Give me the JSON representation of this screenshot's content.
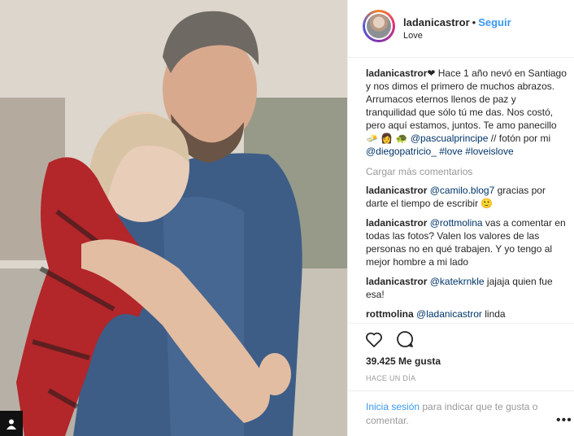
{
  "post": {
    "username": "ladanicastror",
    "separator": "•",
    "follow_label": "Seguir",
    "location": "Love"
  },
  "caption": {
    "username": "ladanicastror",
    "text_1": "❤ Hace 1 año nevó en Santiago y nos dimos el primero de muchos abrazos. Arrumacos eternos llenos de paz y tranquilidad que sólo tú me das. Nos costó, pero aquí estamos, juntos. Te amo panecillo 🧈 👩 🐢 ",
    "mention_1": "@pascualprincipe",
    "text_2": " // fotón por mi ",
    "mention_2": "@diegopatricio_",
    "text_3": " ",
    "tag_1": "#love",
    "text_4": " ",
    "tag_2": "#loveislove"
  },
  "load_more_label": "Cargar más comentarios",
  "comments": [
    {
      "username": "ladanicastror",
      "mention": "@camilo.blog7",
      "text": " gracias por darte el tiempo de escribir 🙂"
    },
    {
      "username": "ladanicastror",
      "mention": "@rottmolina",
      "text": " vas a comentar en todas las fotos? Valen los valores de las personas no en qué trabajen. Y yo tengo al mejor hombre a mi lado"
    },
    {
      "username": "ladanicastror",
      "mention": "@katekrnkle",
      "text": " jajaja quien fue esa!"
    },
    {
      "username": "rottmolina",
      "mention": "@ladanicastror",
      "text": " linda"
    }
  ],
  "likes_label": "39.425 Me gusta",
  "time_label": "HACE UN DÍA",
  "login": {
    "link": "Inicia sesión",
    "text": " para indicar que te gusta o comentar."
  },
  "more_label": "•••",
  "icons": {
    "like": "heart-icon",
    "comment": "comment-icon",
    "more": "more-options-icon",
    "corner": "user-tag-icon"
  },
  "colors": {
    "accent": "#3897f0",
    "mention": "#003569",
    "muted": "#999999"
  }
}
